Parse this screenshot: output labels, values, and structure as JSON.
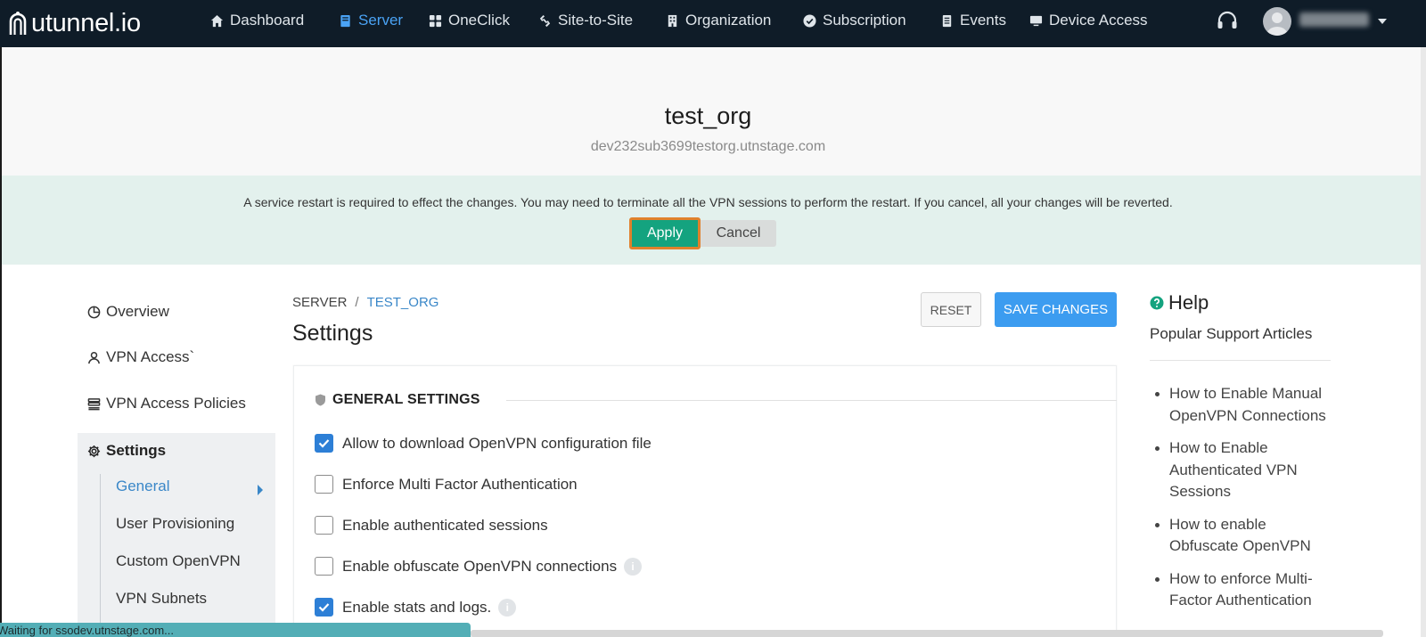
{
  "app": {
    "logo_text": "utunnel.io"
  },
  "nav": {
    "items": [
      {
        "label": "Dashboard",
        "icon": "home-icon"
      },
      {
        "label": "Server",
        "icon": "server-icon"
      },
      {
        "label": "OneClick",
        "icon": "grid-icon"
      },
      {
        "label": "Site-to-Site",
        "icon": "link-icon"
      },
      {
        "label": "Organization",
        "icon": "building-icon"
      },
      {
        "label": "Subscription",
        "icon": "check-circle-icon"
      },
      {
        "label": "Events",
        "icon": "document-icon"
      },
      {
        "label": "Device Access",
        "icon": "monitor-icon"
      }
    ],
    "active": "Server"
  },
  "org": {
    "name": "test_org",
    "host": "dev232sub3699testorg.utnstage.com"
  },
  "banner": {
    "message": "A service restart is required to effect the changes. You may need to terminate all the VPN sessions to perform the restart. If you cancel, all your changes will be reverted.",
    "apply_label": "Apply",
    "cancel_label": "Cancel"
  },
  "sidebar": {
    "items": [
      {
        "label": "Overview",
        "icon": "pie-chart-icon"
      },
      {
        "label": "VPN Access`",
        "icon": "user-icon"
      },
      {
        "label": "VPN Access Policies",
        "icon": "list-icon"
      }
    ],
    "settings": {
      "label": "Settings",
      "icon": "gear-icon",
      "children": [
        "General",
        "User Provisioning",
        "Custom OpenVPN",
        "VPN Subnets"
      ],
      "active_child": "General"
    }
  },
  "main": {
    "breadcrumb": {
      "root": "SERVER",
      "separator": "/",
      "current": "TEST_ORG"
    },
    "title": "Settings",
    "reset_label": "RESET",
    "save_label": "SAVE CHANGES",
    "section_title": "GENERAL SETTINGS",
    "options": [
      {
        "label": "Allow to download OpenVPN configuration file",
        "checked": true,
        "info": false
      },
      {
        "label": "Enforce Multi Factor Authentication",
        "checked": false,
        "info": false
      },
      {
        "label": "Enable authenticated sessions",
        "checked": false,
        "info": false
      },
      {
        "label": "Enable obfuscate OpenVPN connections",
        "checked": false,
        "info": true
      },
      {
        "label": "Enable stats and logs.",
        "checked": true,
        "info": true
      }
    ]
  },
  "help": {
    "title": "Help",
    "subtitle": "Popular Support Articles",
    "articles": [
      "How to Enable Manual OpenVPN Connections",
      "How to Enable Authenticated VPN Sessions",
      "How to enable Obfuscate OpenVPN",
      "How to enforce Multi-Factor Authentication"
    ]
  },
  "status_bar": {
    "text": "Waiting for ssodev.utnstage.com..."
  },
  "colors": {
    "nav_bg": "#0f1c28",
    "nav_active": "#4aa3f5",
    "banner_bg": "#e3f1ed",
    "apply_bg": "#14a37f",
    "apply_outline": "#e0812c",
    "save_bg": "#3c9cf0",
    "checkbox_on": "#2d7fd6",
    "help_icon": "#14a37f"
  }
}
